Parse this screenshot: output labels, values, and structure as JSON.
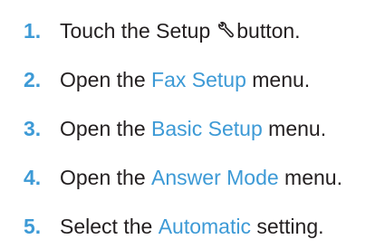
{
  "colors": {
    "accent": "#3d9ad6",
    "link": "#3d9ad6",
    "text": "#231f20"
  },
  "steps": [
    {
      "number": "1.",
      "before": "Touch the Setup",
      "icon": "wrench-icon",
      "after": "button."
    },
    {
      "number": "2.",
      "before": "Open the",
      "link": "Fax Setup",
      "after": "menu."
    },
    {
      "number": "3.",
      "before": "Open the",
      "link": "Basic Setup",
      "after": "menu."
    },
    {
      "number": "4.",
      "before": "Open the",
      "link": "Answer Mode",
      "after": "menu."
    },
    {
      "number": "5.",
      "before": "Select the",
      "link": "Automatic",
      "after": "setting."
    }
  ]
}
